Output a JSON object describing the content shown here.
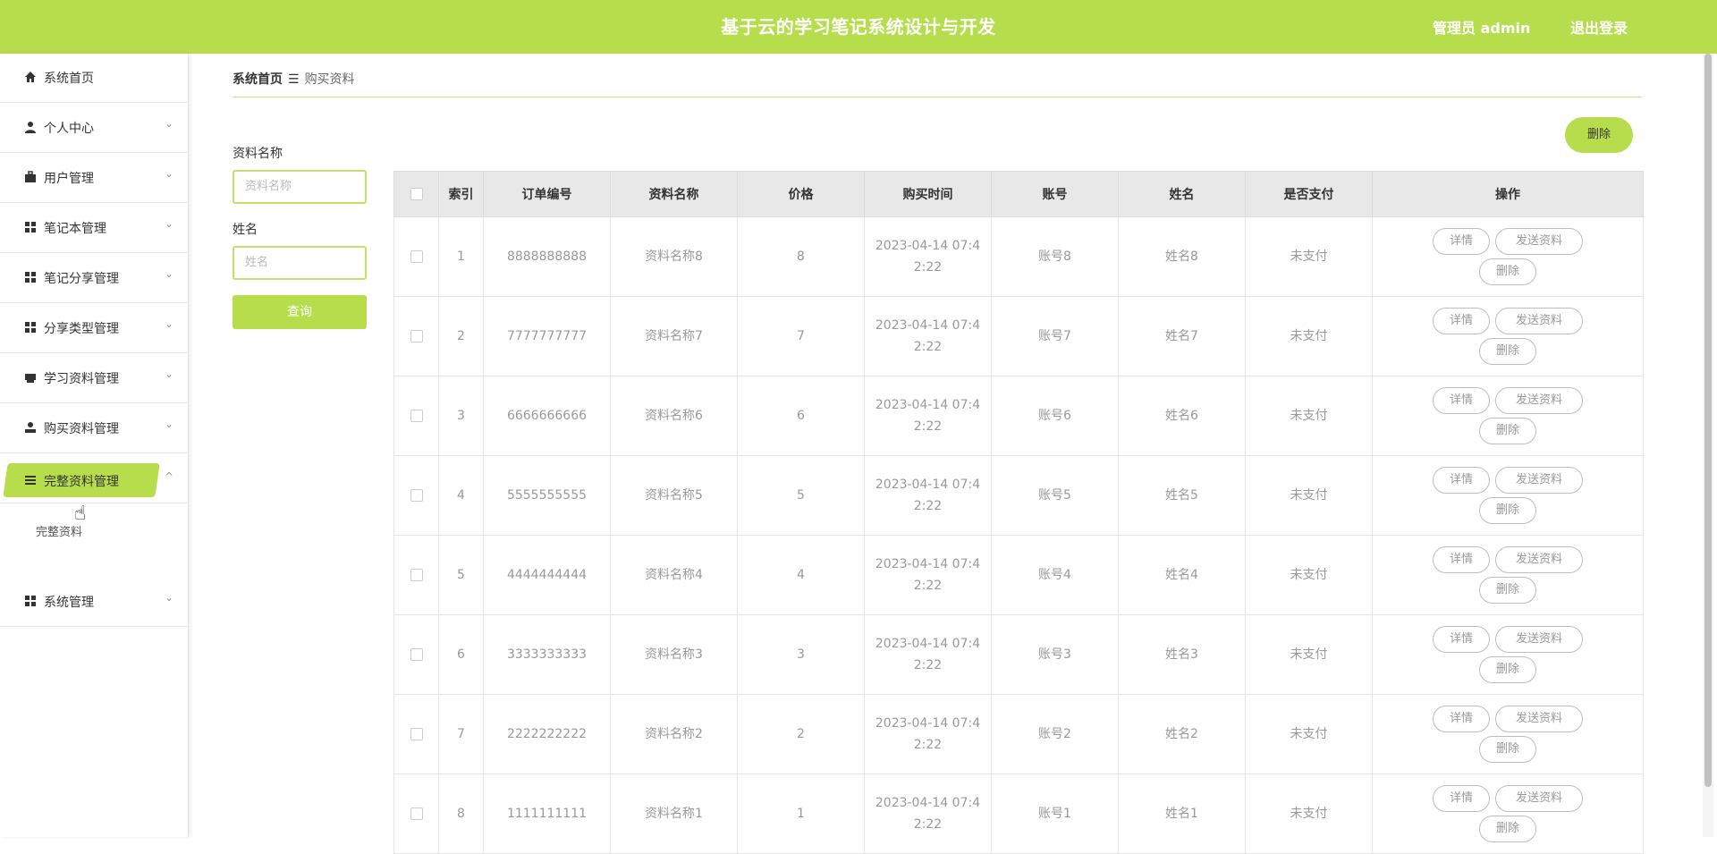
{
  "header": {
    "title": "基于云的学习笔记系统设计与开发",
    "admin_label": "管理员 admin",
    "logout_label": "退出登录"
  },
  "sidebar": {
    "items": [
      {
        "label": "系统首页",
        "icon": "home-icon"
      },
      {
        "label": "个人中心",
        "icon": "user-icon"
      },
      {
        "label": "用户管理",
        "icon": "briefcase-icon"
      },
      {
        "label": "笔记本管理",
        "icon": "grid-icon"
      },
      {
        "label": "笔记分享管理",
        "icon": "grid-icon"
      },
      {
        "label": "分享类型管理",
        "icon": "grid-icon"
      },
      {
        "label": "学习资料管理",
        "icon": "printer-icon"
      },
      {
        "label": "购买资料管理",
        "icon": "person-icon"
      },
      {
        "label": "完整资料管理",
        "icon": "menu-icon"
      },
      {
        "label": "系统管理",
        "icon": "grid-icon"
      }
    ],
    "submenu_label": "完整资料"
  },
  "breadcrumb": {
    "home": "系统首页",
    "sep": "☰",
    "current": "购买资料"
  },
  "filters": {
    "name_label": "资料名称",
    "name_placeholder": "资料名称",
    "person_label": "姓名",
    "person_placeholder": "姓名",
    "query_label": "查询",
    "delete_label": "删除"
  },
  "table": {
    "headers": [
      "索引",
      "订单编号",
      "资料名称",
      "价格",
      "购买时间",
      "账号",
      "姓名",
      "是否支付",
      "操作"
    ],
    "rows": [
      {
        "index": "1",
        "order": "8888888888",
        "name": "资料名称8",
        "price": "8",
        "time_a": "2023-04-14 07:4",
        "time_b": "2:22",
        "account": "账号8",
        "person": "姓名8",
        "paid": "未支付"
      },
      {
        "index": "2",
        "order": "7777777777",
        "name": "资料名称7",
        "price": "7",
        "time_a": "2023-04-14 07:4",
        "time_b": "2:22",
        "account": "账号7",
        "person": "姓名7",
        "paid": "未支付"
      },
      {
        "index": "3",
        "order": "6666666666",
        "name": "资料名称6",
        "price": "6",
        "time_a": "2023-04-14 07:4",
        "time_b": "2:22",
        "account": "账号6",
        "person": "姓名6",
        "paid": "未支付"
      },
      {
        "index": "4",
        "order": "5555555555",
        "name": "资料名称5",
        "price": "5",
        "time_a": "2023-04-14 07:4",
        "time_b": "2:22",
        "account": "账号5",
        "person": "姓名5",
        "paid": "未支付"
      },
      {
        "index": "5",
        "order": "4444444444",
        "name": "资料名称4",
        "price": "4",
        "time_a": "2023-04-14 07:4",
        "time_b": "2:22",
        "account": "账号4",
        "person": "姓名4",
        "paid": "未支付"
      },
      {
        "index": "6",
        "order": "3333333333",
        "name": "资料名称3",
        "price": "3",
        "time_a": "2023-04-14 07:4",
        "time_b": "2:22",
        "account": "账号3",
        "person": "姓名3",
        "paid": "未支付"
      },
      {
        "index": "7",
        "order": "2222222222",
        "name": "资料名称2",
        "price": "2",
        "time_a": "2023-04-14 07:4",
        "time_b": "2:22",
        "account": "账号2",
        "person": "姓名2",
        "paid": "未支付"
      },
      {
        "index": "8",
        "order": "1111111111",
        "name": "资料名称1",
        "price": "1",
        "time_a": "2023-04-14 07:4",
        "time_b": "2:22",
        "account": "账号1",
        "person": "姓名1",
        "paid": "未支付"
      }
    ],
    "actions": {
      "detail": "详情",
      "send": "发送资料",
      "delete": "删除"
    }
  },
  "colors": {
    "accent": "#b7dd4c"
  }
}
